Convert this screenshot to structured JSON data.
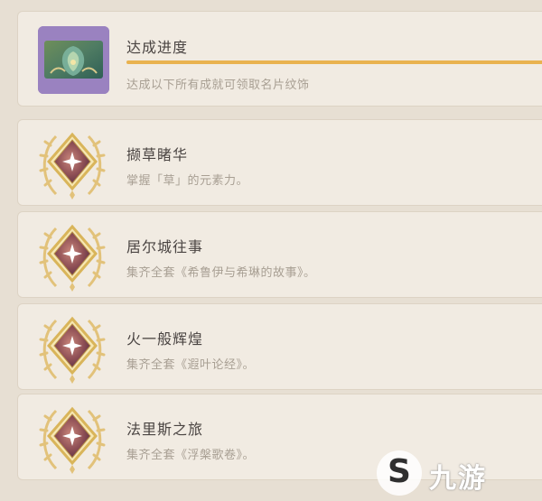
{
  "header": {
    "title": "达成进度",
    "description": "达成以下所有成就可领取名片纹饰",
    "progress": 1.0,
    "accent": "#e9b24f"
  },
  "achievements": [
    {
      "title": "撷草睹华",
      "description": "掌握「草」的元素力。"
    },
    {
      "title": "居尔城往事",
      "description": "集齐全套《希鲁伊与希琳的故事》。"
    },
    {
      "title": "火一般辉煌",
      "description": "集齐全套《遐叶论经》。"
    },
    {
      "title": "法里斯之旅",
      "description": "集齐全套《浮槃歌卷》。"
    }
  ],
  "watermark": {
    "letter": "S",
    "text": "九游"
  }
}
